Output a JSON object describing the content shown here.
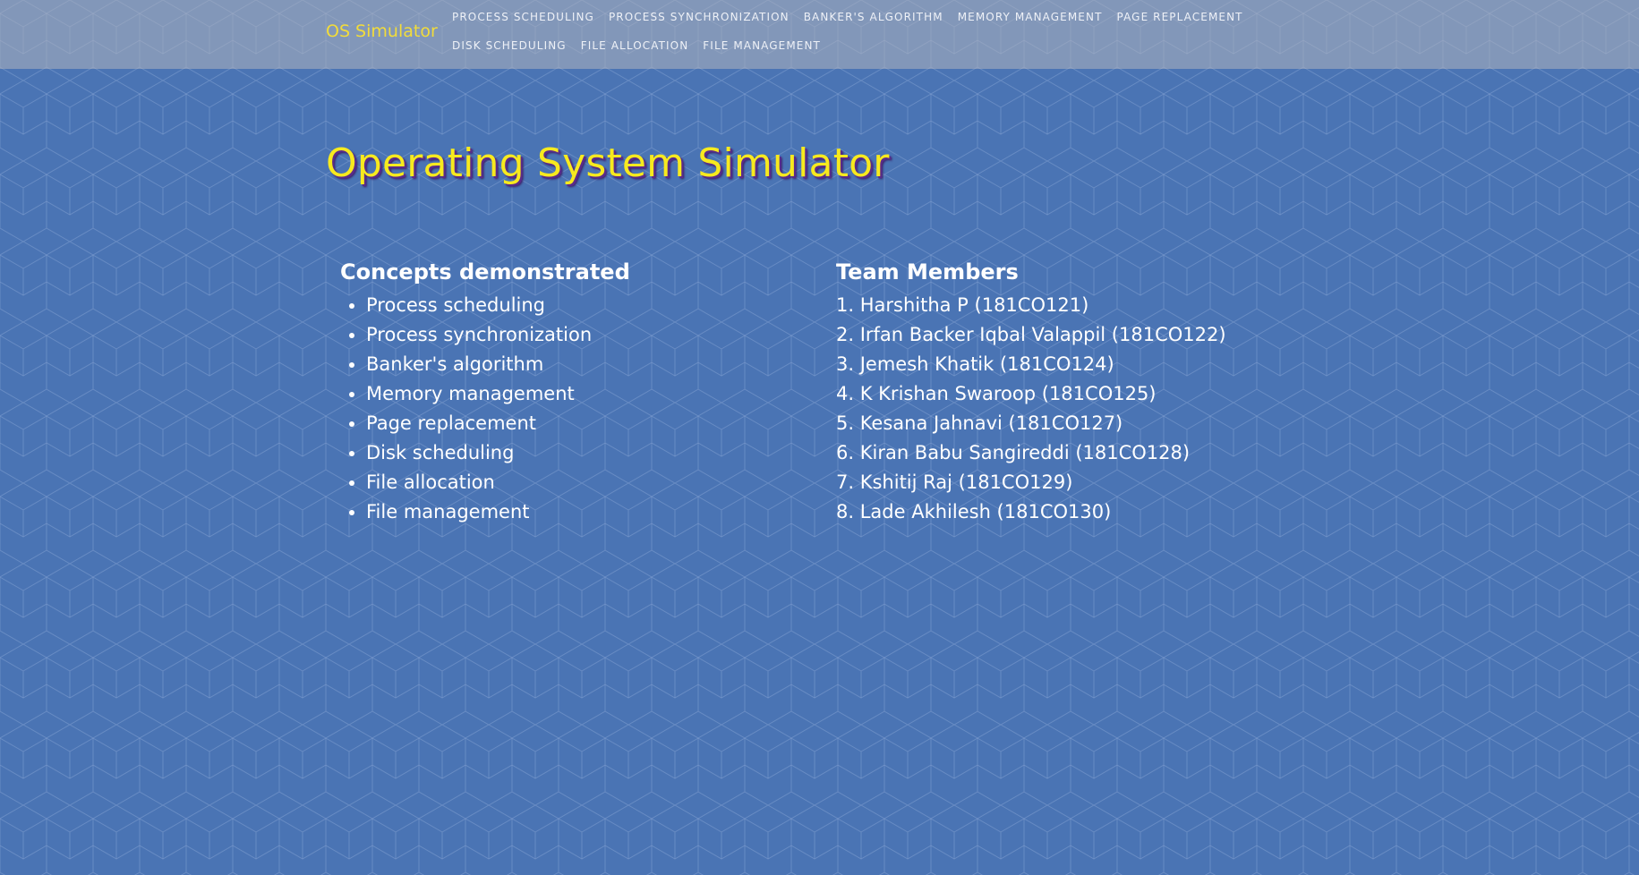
{
  "brand": "OS Simulator",
  "nav": {
    "row1": [
      "Process Scheduling",
      "Process Synchronization",
      "Banker's Algorithm",
      "Memory Management",
      "Page Replacement"
    ],
    "row2": [
      "Disk Scheduling",
      "File Allocation",
      "File Management"
    ]
  },
  "page_title": "Operating System Simulator",
  "concepts": {
    "heading": "Concepts demonstrated",
    "items": [
      "Process scheduling",
      "Process synchronization",
      "Banker's algorithm",
      "Memory management",
      "Page replacement",
      "Disk scheduling",
      "File allocation",
      "File management"
    ]
  },
  "team": {
    "heading": "Team Members",
    "members": [
      "1. Harshitha P (181CO121)",
      "2. Irfan Backer Iqbal Valappil (181CO122)",
      "3. Jemesh Khatik (181CO124)",
      "4. K Krishan Swaroop (181CO125)",
      "5. Kesana Jahnavi (181CO127)",
      "6. Kiran Babu Sangireddi (181CO128)",
      "7. Kshitij Raj (181CO129)",
      "8. Lade Akhilesh (181CO130)"
    ]
  },
  "colors": {
    "background": "#4a74b4",
    "brand": "#f2dc3a",
    "title": "#f7ea1e",
    "title_shadow": "#5b2a8a"
  }
}
